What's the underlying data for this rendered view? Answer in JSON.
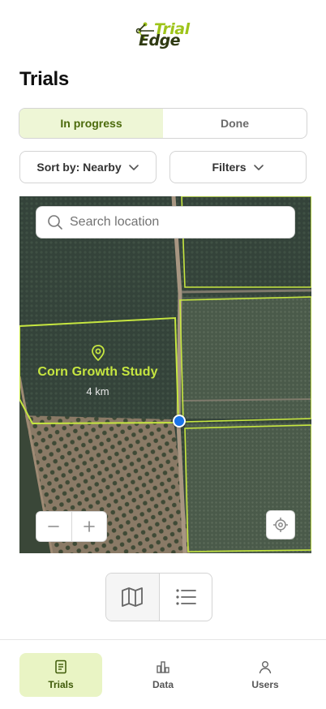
{
  "brand": {
    "word1": "Trial",
    "word2": "Edge"
  },
  "page": {
    "title": "Trials"
  },
  "tabs": [
    {
      "label": "In progress",
      "active": true
    },
    {
      "label": "Done",
      "active": false
    }
  ],
  "filters": {
    "sort_label": "Sort by: Nearby",
    "filters_label": "Filters"
  },
  "map": {
    "search_placeholder": "Search location",
    "trial": {
      "name": "Corn Growth Study",
      "distance": "4 km"
    }
  },
  "icons": {
    "zoom_out": "minus-icon",
    "zoom_in": "plus-icon",
    "locate": "crosshair-icon",
    "map_view": "map-icon",
    "list_view": "list-icon"
  },
  "nav": [
    {
      "label": "Trials",
      "icon": "document-icon",
      "active": true
    },
    {
      "label": "Data",
      "icon": "bar-chart-icon",
      "active": false
    },
    {
      "label": "Users",
      "icon": "user-icon",
      "active": false
    }
  ],
  "colors": {
    "accent": "#9ec41a",
    "field_outline": "#c6e640",
    "active_tab_bg": "#eef6d6",
    "user_location": "#1a73e8"
  }
}
